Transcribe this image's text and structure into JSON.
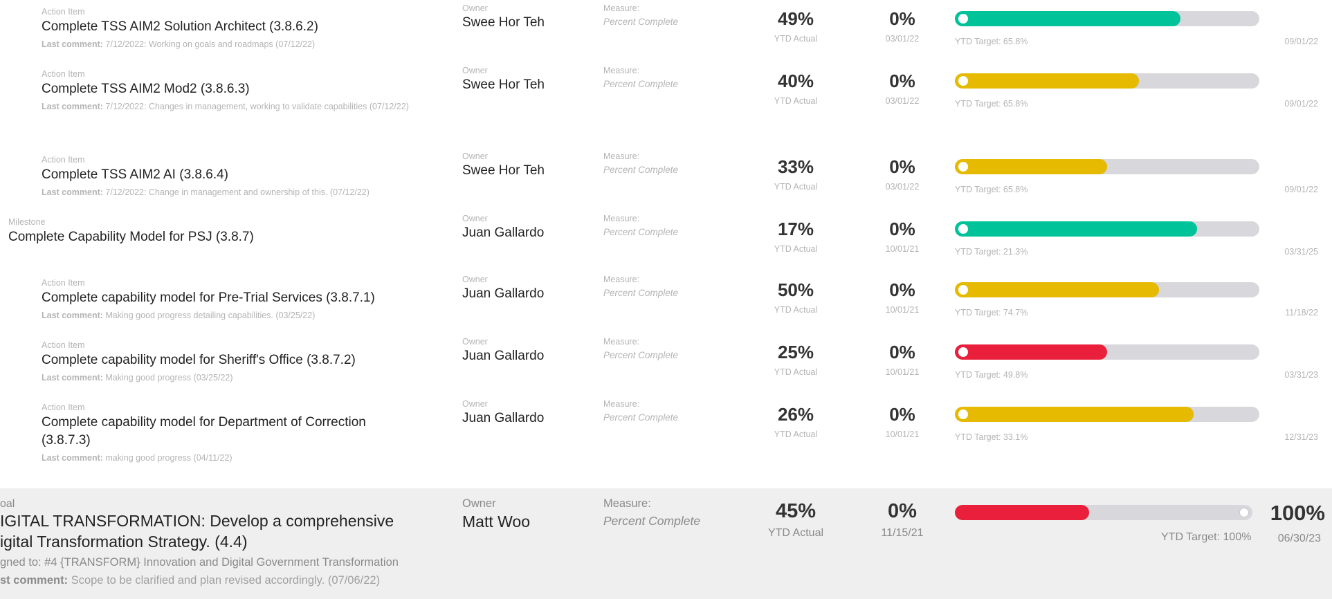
{
  "colors": {
    "green": "#00c39a",
    "yellow": "#e5ba00",
    "red": "#ea1f3c",
    "track": "#d7d7dc"
  },
  "rows": [
    {
      "type": "Action Item",
      "title": "Complete TSS AIM2 Solution Architect (3.8.6.2)",
      "comment_label": "Last comment:",
      "comment": "7/12/2022: Working on goals and roadmaps (07/12/22)",
      "owner_label": "Owner",
      "owner": "Swee Hor Teh",
      "measure_label": "Measure:",
      "measure": "Percent Complete",
      "ytd": "49%",
      "ytd_label": "YTD Actual",
      "pct": "0%",
      "start_date": "03/01/22",
      "progress": 0.74,
      "status": "green",
      "target": "YTD Target: 65.8%",
      "end_date": "09/01/22"
    },
    {
      "type": "Action Item",
      "title": "Complete TSS AIM2 Mod2 (3.8.6.3)",
      "comment_label": "Last comment:",
      "comment": "7/12/2022: Changes in management, working to validate capabilities (07/12/22)",
      "owner_label": "Owner",
      "owner": "Swee Hor Teh",
      "measure_label": "Measure:",
      "measure": "Percent Complete",
      "ytd": "40%",
      "ytd_label": "YTD Actual",
      "pct": "0%",
      "start_date": "03/01/22",
      "progress": 0.605,
      "status": "yellow",
      "target": "YTD Target: 65.8%",
      "end_date": "09/01/22"
    },
    {
      "type": "Action Item",
      "title": "Complete TSS AIM2 AI (3.8.6.4)",
      "comment_label": "Last comment:",
      "comment": "7/12/2022: Change in management and ownership of this. (07/12/22)",
      "owner_label": "Owner",
      "owner": "Swee Hor Teh",
      "measure_label": "Measure:",
      "measure": "Percent Complete",
      "ytd": "33%",
      "ytd_label": "YTD Actual",
      "pct": "0%",
      "start_date": "03/01/22",
      "progress": 0.5,
      "status": "yellow",
      "target": "YTD Target: 65.8%",
      "end_date": "09/01/22"
    },
    {
      "type": "Milestone",
      "title": "Complete Capability Model for PSJ (3.8.7)",
      "comment_label": "",
      "comment": "",
      "owner_label": "Owner",
      "owner": "Juan Gallardo",
      "measure_label": "Measure:",
      "measure": "Percent Complete",
      "ytd": "17%",
      "ytd_label": "YTD Actual",
      "pct": "0%",
      "start_date": "10/01/21",
      "progress": 0.795,
      "status": "green",
      "target": "YTD Target: 21.3%",
      "end_date": "03/31/25"
    },
    {
      "type": "Action Item",
      "title": "Complete capability model for Pre-Trial Services (3.8.7.1)",
      "comment_label": "Last comment:",
      "comment": "Making good progress detailing capabilities. (03/25/22)",
      "owner_label": "Owner",
      "owner": "Juan Gallardo",
      "measure_label": "Measure:",
      "measure": "Percent Complete",
      "ytd": "50%",
      "ytd_label": "YTD Actual",
      "pct": "0%",
      "start_date": "10/01/21",
      "progress": 0.67,
      "status": "yellow",
      "target": "YTD Target: 74.7%",
      "end_date": "11/18/22"
    },
    {
      "type": "Action Item",
      "title": "Complete capability model for Sheriff's Office (3.8.7.2)",
      "comment_label": "Last comment:",
      "comment": "Making good progress (03/25/22)",
      "owner_label": "Owner",
      "owner": "Juan Gallardo",
      "measure_label": "Measure:",
      "measure": "Percent Complete",
      "ytd": "25%",
      "ytd_label": "YTD Actual",
      "pct": "0%",
      "start_date": "10/01/21",
      "progress": 0.5,
      "status": "red",
      "target": "YTD Target: 49.8%",
      "end_date": "03/31/23"
    },
    {
      "type": "Action Item",
      "title": "Complete capability model for Department of Correction (3.8.7.3)",
      "comment_label": "Last comment:",
      "comment": "making good progress (04/11/22)",
      "owner_label": "Owner",
      "owner": "Juan Gallardo",
      "measure_label": "Measure:",
      "measure": "Percent Complete",
      "ytd": "26%",
      "ytd_label": "YTD Actual",
      "pct": "0%",
      "start_date": "10/01/21",
      "progress": 0.785,
      "status": "yellow",
      "target": "YTD Target: 33.1%",
      "end_date": "12/31/23"
    }
  ],
  "goal": {
    "type": "oal",
    "title_line1": "IGITAL TRANSFORMATION: Develop a comprehensive",
    "title_line2": "igital Transformation Strategy. (4.4)",
    "assigned": "gned to: #4 {TRANSFORM} Innovation and Digital Government Transformation",
    "comment_label": "st comment:",
    "comment": "Scope to be clarified and plan revised accordingly. (07/06/22)",
    "owner_label": "Owner",
    "owner": "Matt Woo",
    "measure_label": "Measure:",
    "measure": "Percent Complete",
    "ytd": "45%",
    "ytd_label": "YTD Actual",
    "pct": "0%",
    "start_date": "11/15/21",
    "progress": 0.45,
    "status": "red",
    "target": "YTD Target: 100%",
    "end_date": "06/30/23",
    "target_value": "100%"
  }
}
